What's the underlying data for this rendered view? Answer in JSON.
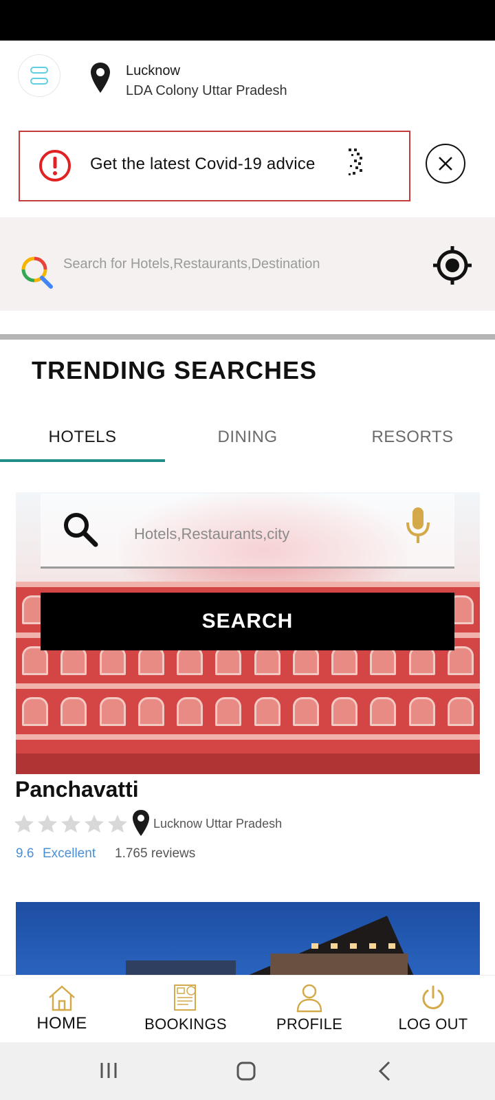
{
  "header": {
    "city": "Lucknow",
    "area": "LDA Colony Uttar Pradesh"
  },
  "covid_banner": {
    "text": "Get the latest Covid-19 advice"
  },
  "search": {
    "placeholder": "Search for Hotels,Restaurants,Destination"
  },
  "trending": {
    "title": "TRENDING SEARCHES",
    "tabs": [
      {
        "label": "HOTELS",
        "active": true
      },
      {
        "label": "DINING",
        "active": false
      },
      {
        "label": "RESORTS",
        "active": false
      }
    ]
  },
  "hero_search": {
    "placeholder": "Hotels,Restaurants,city",
    "button_label": "SEARCH"
  },
  "listing": {
    "name": "Panchavatti",
    "stars": 0,
    "location": "Lucknow Uttar Pradesh",
    "score": "9.6",
    "rating_word": "Excellent",
    "reviews": "1.765 reviews"
  },
  "bottom_nav": [
    {
      "label": "HOME",
      "icon": "home-icon"
    },
    {
      "label": "BOOKINGS",
      "icon": "bookings-icon"
    },
    {
      "label": "PROFILE",
      "icon": "profile-icon"
    },
    {
      "label": "LOG OUT",
      "icon": "power-icon"
    }
  ],
  "colors": {
    "accent_teal": "#1f8e86",
    "alert_red": "#c43b3b",
    "gold": "#d4a94a",
    "link_blue": "#4a8fd6"
  }
}
